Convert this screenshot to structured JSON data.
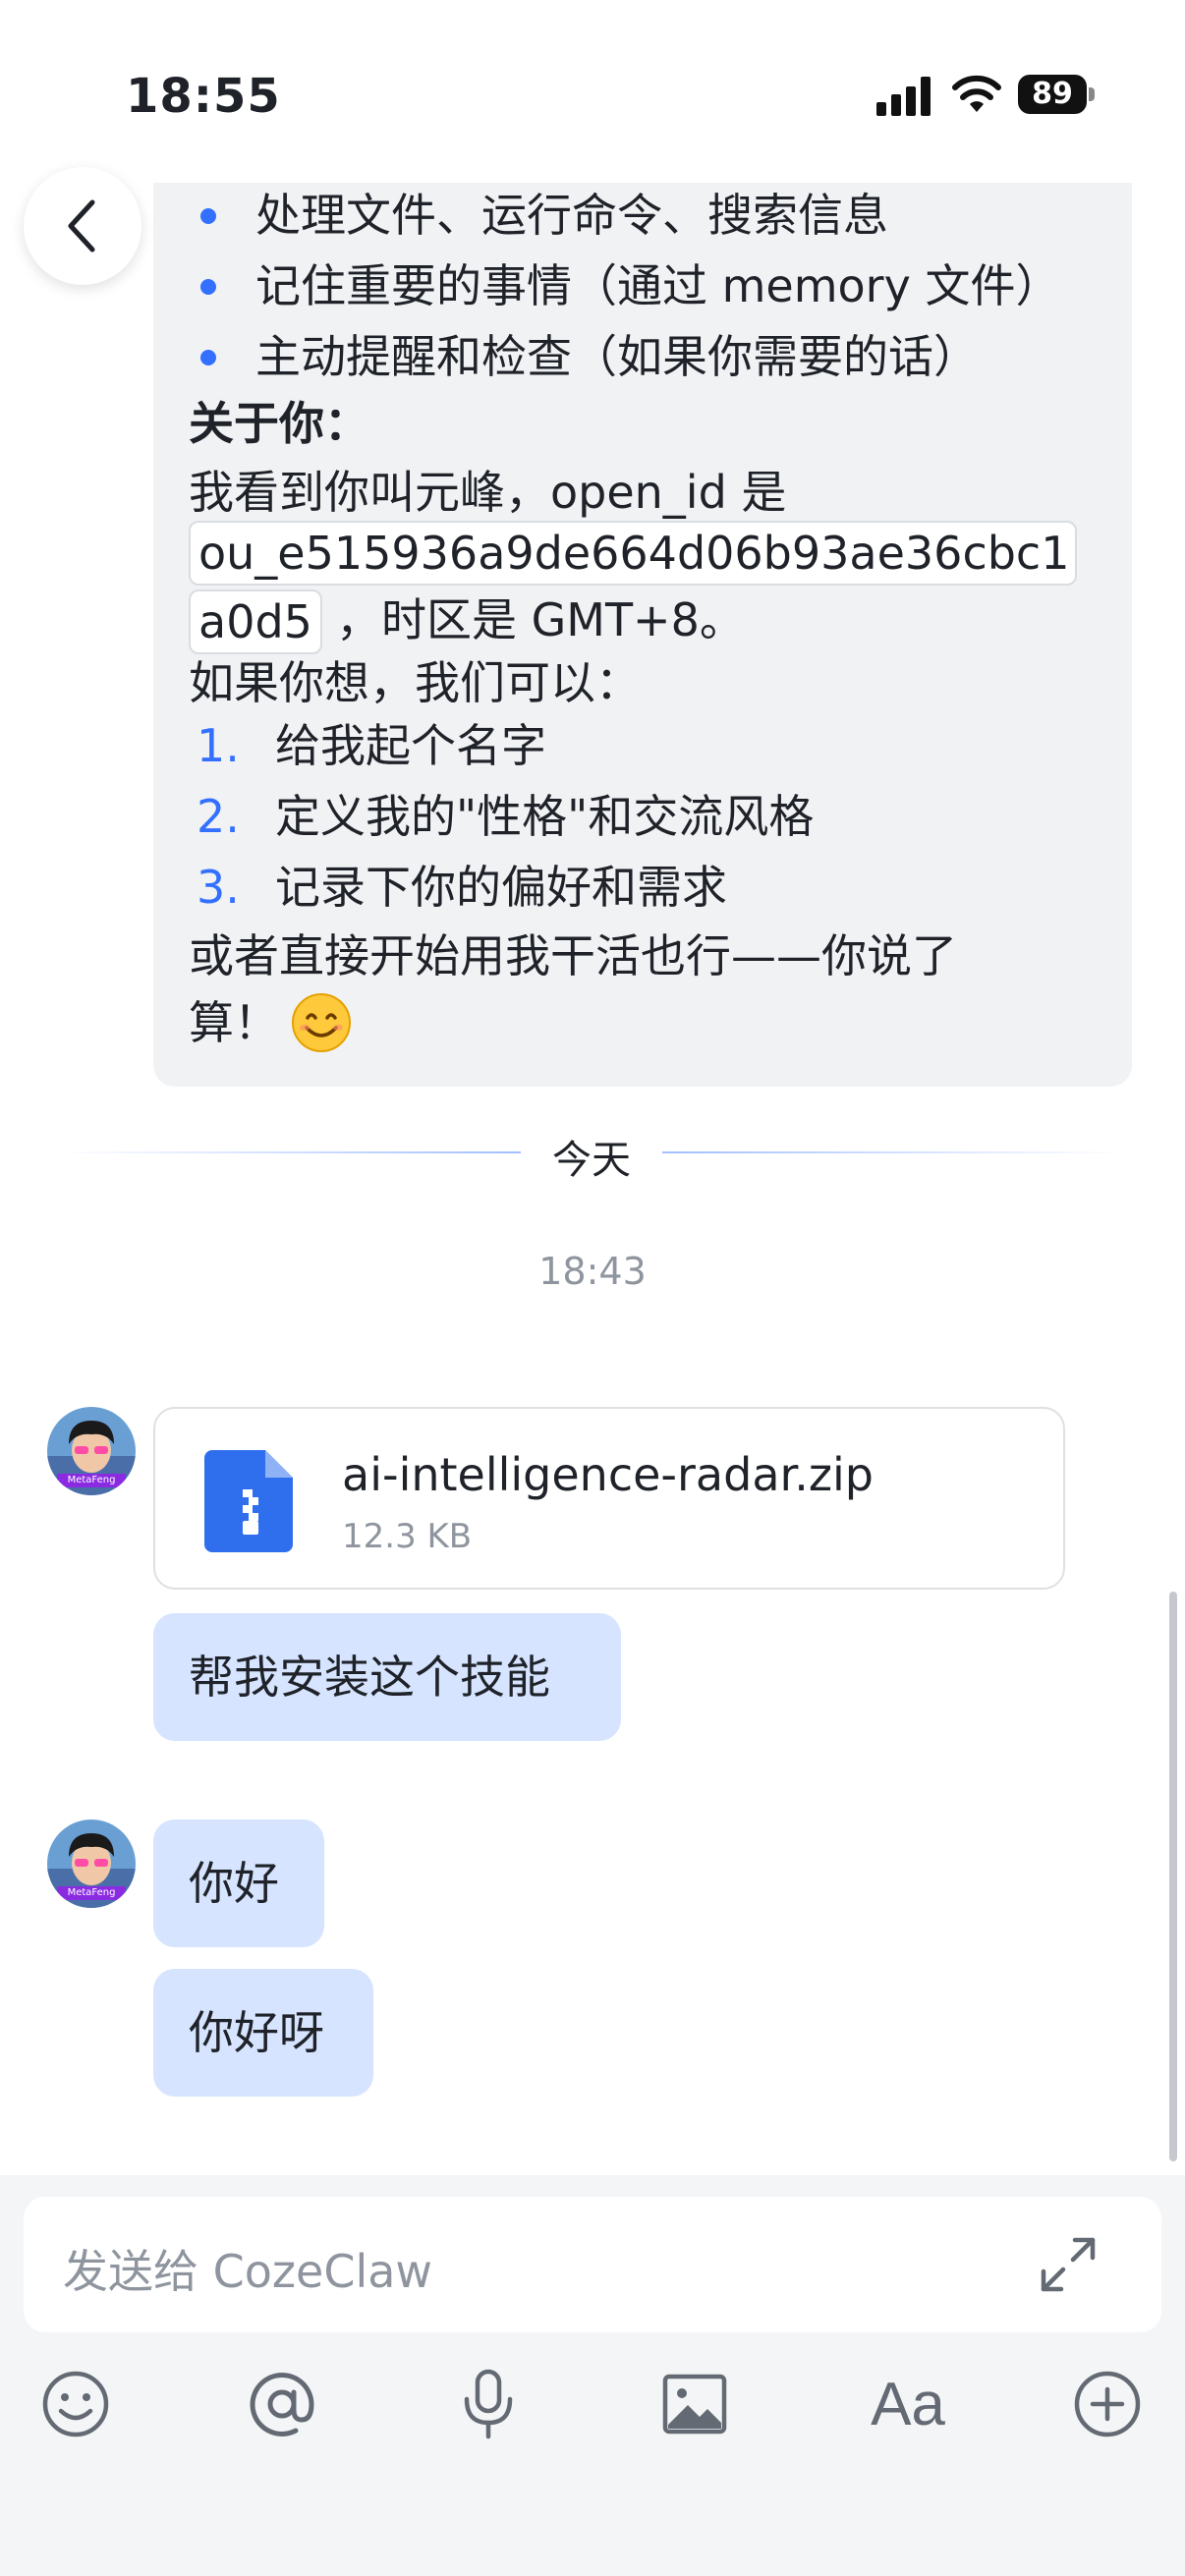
{
  "status_bar": {
    "time": "18:55",
    "battery": "89"
  },
  "conversation": {
    "bot_message": {
      "bullets": [
        "处理文件、运行命令、搜索信息",
        "记住重要的事情（通过 memory 文件）",
        "主动提醒和检查（如果你需要的话）"
      ],
      "about_heading": "关于你：",
      "about_line1": "我看到你叫元峰，open_id 是",
      "open_id_part1": "ou_e515936a9de664d06b93ae36cbc1",
      "open_id_part2": "a0d5",
      "timezone_text": "，时区是 GMT+8。",
      "options_intro": "如果你想，我们可以：",
      "options": [
        {
          "num": "1.",
          "text": "给我起个名字"
        },
        {
          "num": "2.",
          "text": "定义我的\"性格\"和交流风格"
        },
        {
          "num": "3.",
          "text": "记录下你的偏好和需求"
        }
      ],
      "closing_line1": "或者直接开始用我干活也行——你说了",
      "closing_line2": "算！",
      "emoji": "😊"
    },
    "divider_label": "今天",
    "timestamp": "18:43",
    "file": {
      "name": "ai-intelligence-radar.zip",
      "size": "12.3 KB"
    },
    "user_messages": [
      "帮我安装这个技能",
      "你好",
      "你好呀"
    ],
    "avatar_caption": "MetaFeng"
  },
  "composer": {
    "placeholder": "发送给 CozeClaw",
    "font_button_label": "Aa"
  },
  "colors": {
    "accent": "#3370ff",
    "user_bubble": "#d6e4ff",
    "bot_bubble": "#f1f2f4"
  }
}
